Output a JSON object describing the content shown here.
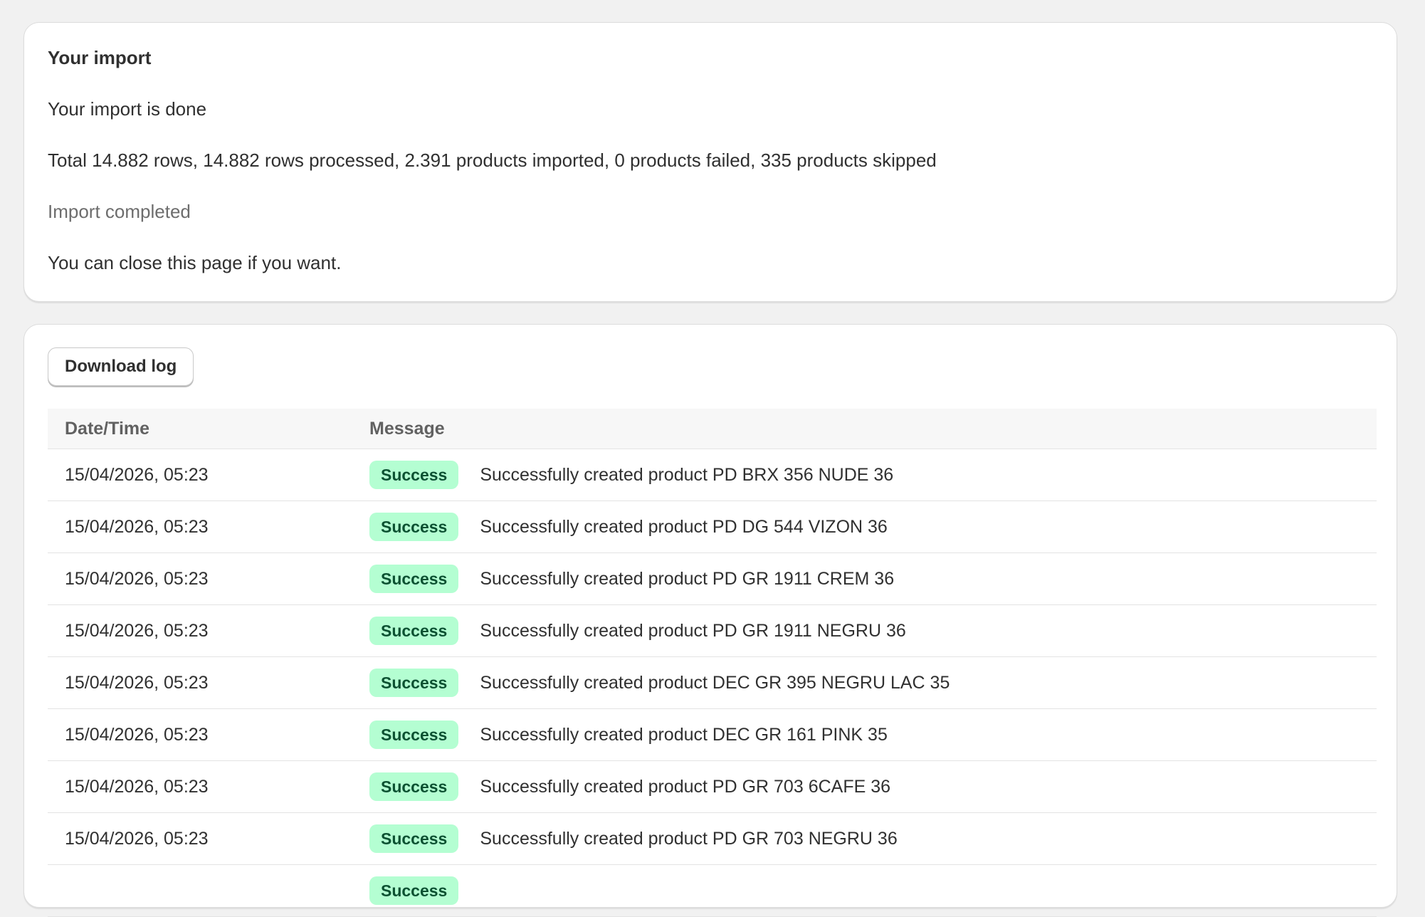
{
  "import_card": {
    "title": "Your import",
    "status_line": "Your import is done",
    "summary": "Total 14.882 rows, 14.882 rows processed, 2.391 products imported, 0 products failed, 335 products skipped",
    "state": "Import completed",
    "hint": "You can close this page if you want."
  },
  "log_card": {
    "download_label": "Download log",
    "columns": {
      "date": "Date/Time",
      "message": "Message"
    },
    "badge_color": "#b4fed2",
    "rows": [
      {
        "datetime": "15/04/2026, 05:23",
        "status": "Success",
        "message": "Successfully created product PD BRX 356 NUDE 36"
      },
      {
        "datetime": "15/04/2026, 05:23",
        "status": "Success",
        "message": "Successfully created product PD DG 544 VIZON 36"
      },
      {
        "datetime": "15/04/2026, 05:23",
        "status": "Success",
        "message": "Successfully created product PD GR 1911 CREM 36"
      },
      {
        "datetime": "15/04/2026, 05:23",
        "status": "Success",
        "message": "Successfully created product PD GR 1911 NEGRU 36"
      },
      {
        "datetime": "15/04/2026, 05:23",
        "status": "Success",
        "message": "Successfully created product DEC GR 395 NEGRU LAC 35"
      },
      {
        "datetime": "15/04/2026, 05:23",
        "status": "Success",
        "message": "Successfully created product DEC GR 161 PINK 35"
      },
      {
        "datetime": "15/04/2026, 05:23",
        "status": "Success",
        "message": "Successfully created product PD GR 703 6CAFE 36"
      },
      {
        "datetime": "15/04/2026, 05:23",
        "status": "Success",
        "message": "Successfully created product PD GR 703 NEGRU 36"
      },
      {
        "datetime": "",
        "status": "Success",
        "message": ""
      }
    ]
  }
}
